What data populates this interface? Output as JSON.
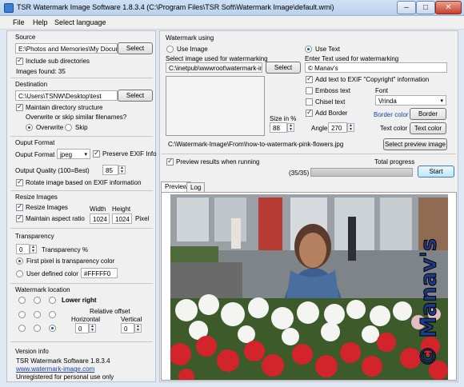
{
  "window": {
    "title": "TSR Watermark Image Software 1.8.3.4 (C:\\Program Files\\TSR Soft\\Watermark Image\\default.wmi)",
    "minimize": "–",
    "maximize": "□",
    "close": "✕"
  },
  "menu": [
    "File",
    "Help",
    "Select language"
  ],
  "source": {
    "title": "Source",
    "path": "E:\\Photos and Memories\\My Docume",
    "select_label": "Select",
    "include_sub_label": "Include sub directories",
    "images_found": "Images found: 35"
  },
  "destination": {
    "title": "Destination",
    "path": "C:\\Users\\TSNW\\Desktop\\test",
    "select_label": "Select",
    "maintain_label": "Maintain directory structure",
    "overwrite_question": "Overwrite or skip similar filenames?",
    "overwrite_label": "Overwrite",
    "skip_label": "Skip"
  },
  "output": {
    "title": "Ouput Format",
    "format_label": "Ouput Format",
    "format_value": "jpeg",
    "preserve_label": "Preserve EXIF Info",
    "quality_label": "Output Quality (100=Best)",
    "quality_value": "85",
    "rotate_label": "Rotate image based on EXIF information"
  },
  "resize": {
    "title": "Resize Images",
    "resize_label": "Resize Images",
    "aspect_label": "Maintain aspect ratio",
    "width_label": "Width",
    "height_label": "Height",
    "width_value": "1024",
    "height_value": "1024",
    "unit": "Pixel"
  },
  "transparency": {
    "title": "Transparency",
    "value": "0",
    "percent_label": "Transparency %",
    "first_pixel_label": "First pixel is transparency color",
    "user_defined_label": "User defined color",
    "color_value": "#FFFFF0"
  },
  "location": {
    "title": "Watermark location",
    "selected_label": "Lower right",
    "relative_offset": "Relative offset",
    "horizontal_label": "Horizontal",
    "vertical_label": "Vertical",
    "horizontal_value": "0",
    "vertical_value": "0"
  },
  "version": {
    "title": "Version info",
    "name": "TSR Watermark Software 1.8.3.4",
    "url": "www.watermark-image.com",
    "license": "Unregistered for personal use only"
  },
  "watermark": {
    "title": "Watermark using",
    "use_image_label": "Use Image",
    "use_text_label": "Use Text",
    "select_image_label": "Select image used for watermarking",
    "image_path": "C:\\inetpub\\wwwroot\\watermark-ima",
    "select_label": "Select",
    "size_label": "Size in %",
    "size_value": "88",
    "enter_text_label": "Enter Text used for watermarking",
    "text_value": "© Manav's",
    "exif_copyright_label": "Add text to EXIF \"Copyright\" information",
    "emboss_label": "Emboss text",
    "chisel_label": "Chisel text",
    "font_label": "Font",
    "font_value": "Vrinda",
    "add_border_label": "Add Border",
    "border_color_label": "Border color",
    "border_button": "Border",
    "angle_label": "Angle",
    "angle_value": "270",
    "text_color_label": "Text color",
    "text_color_button": "Text color",
    "preview_file": "C:\\Watermark-Image\\From\\how-to-watermark-pink-flowers.jpg",
    "select_preview_label": "Select preview image"
  },
  "run": {
    "preview_label": "Preview results when running",
    "total_progress_label": "Total progress",
    "count": "(35/35)",
    "progress_fraction": 1.0,
    "start_label": "Start"
  },
  "tabs": [
    "Preview",
    "Log"
  ],
  "preview_watermark_text": "© Manav's",
  "colors": {
    "accent": "#1a3ea8",
    "title_bar": "#c5d9f1"
  }
}
